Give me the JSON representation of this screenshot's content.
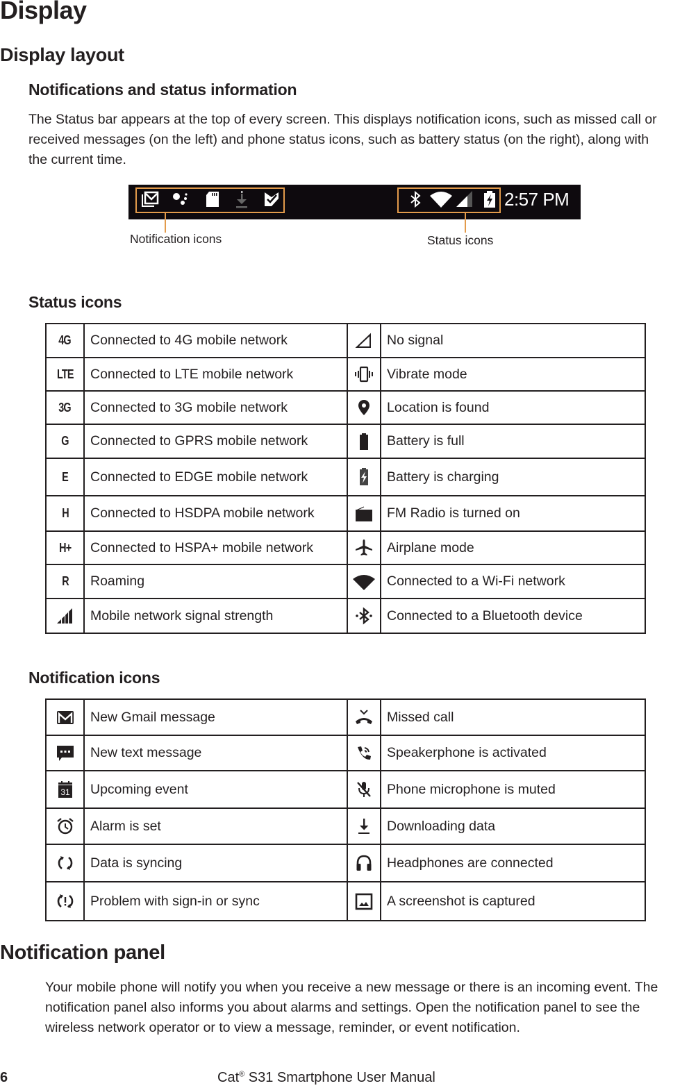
{
  "page": {
    "title": "Display",
    "section_title": "Display layout",
    "subsection_title": "Notifications and status information",
    "intro_text": "The Status bar appears at the top of every screen. This displays notification icons, such as missed call or received messages (on the left) and phone status icons, such as battery status (on the right), along with the current time."
  },
  "status_bar_figure": {
    "time": "2:57 PM",
    "notification_icons": [
      "gmail-icon",
      "assistant-dots-icon",
      "sd-card-icon",
      "download-icon",
      "checkmark-flag-icon"
    ],
    "status_icons": [
      "bluetooth-icon",
      "wifi-icon",
      "signal-icon",
      "battery-charging-icon"
    ],
    "notification_caption": "Notification icons",
    "status_caption": "Status icons",
    "highlight_color": "#e39b4b",
    "bar_color": "#0e0a0e"
  },
  "status_icons_section": {
    "heading": "Status icons",
    "rows": [
      {
        "left_icon": "4G",
        "left_text": "Connected to 4G mobile network",
        "right_icon": "no-signal-icon",
        "right_text": "No signal"
      },
      {
        "left_icon": "LTE",
        "left_text": "Connected to LTE mobile network",
        "right_icon": "vibrate-icon",
        "right_text": "Vibrate mode"
      },
      {
        "left_icon": "3G",
        "left_text": "Connected to 3G mobile network",
        "right_icon": "location-icon",
        "right_text": "Location is found"
      },
      {
        "left_icon": "G",
        "left_text": "Connected to GPRS mobile network",
        "right_icon": "battery-full-icon",
        "right_text": "Battery is full"
      },
      {
        "left_icon": "E",
        "left_text": "Connected to EDGE mobile network",
        "right_icon": "battery-charging-icon",
        "right_text": "Battery is charging"
      },
      {
        "left_icon": "H",
        "left_text": "Connected to HSDPA mobile network",
        "right_icon": "fm-radio-icon",
        "right_text": "FM Radio is turned on"
      },
      {
        "left_icon": "H+",
        "left_text": "Connected to HSPA+ mobile network",
        "right_icon": "airplane-icon",
        "right_text": "Airplane mode"
      },
      {
        "left_icon": "R",
        "left_text": "Roaming",
        "right_icon": "wifi-icon",
        "right_text": "Connected to a Wi-Fi network"
      },
      {
        "left_icon": "signal-strength-icon",
        "left_text": "Mobile network signal strength",
        "right_icon": "bluetooth-connected-icon",
        "right_text": "Connected to a Bluetooth device"
      }
    ]
  },
  "notification_icons_section": {
    "heading": "Notification icons",
    "rows": [
      {
        "left_icon": "gmail-icon",
        "left_text": "New Gmail message",
        "right_icon": "missed-call-icon",
        "right_text": "Missed call"
      },
      {
        "left_icon": "text-message-icon",
        "left_text": "New text message",
        "right_icon": "speakerphone-icon",
        "right_text": "Speakerphone is activated"
      },
      {
        "left_icon": "calendar-icon",
        "left_text": "Upcoming event",
        "left_icon_label": "31",
        "right_icon": "mic-muted-icon",
        "right_text": "Phone microphone is muted"
      },
      {
        "left_icon": "alarm-icon",
        "left_text": "Alarm is set",
        "right_icon": "download-icon",
        "right_text": "Downloading data"
      },
      {
        "left_icon": "sync-icon",
        "left_text": "Data is syncing",
        "right_icon": "headphones-icon",
        "right_text": "Headphones are connected"
      },
      {
        "left_icon": "sync-problem-icon",
        "left_text": "Problem with sign-in or sync",
        "right_icon": "screenshot-icon",
        "right_text": "A screenshot is captured"
      }
    ]
  },
  "notification_panel": {
    "heading": "Notification panel",
    "text": "Your mobile phone will notify you when you receive a new message or there is an incoming event. The notification panel also informs you about alarms and settings. Open the notification panel to see the wireless network operator or to view a message, reminder, or event notification."
  },
  "footer": {
    "page_number": "6",
    "manual_title_prefix": "Cat",
    "registered_mark": "®",
    "manual_title_suffix": " S31 Smartphone User Manual"
  }
}
